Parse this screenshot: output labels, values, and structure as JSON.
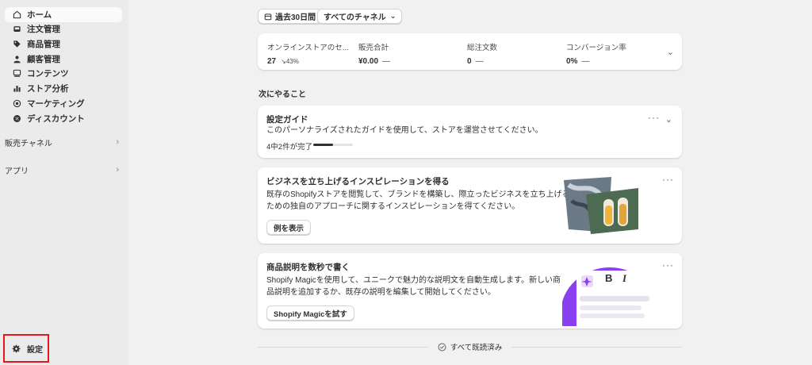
{
  "sidebar": {
    "items": [
      {
        "label": "ホーム",
        "icon": "home-icon"
      },
      {
        "label": "注文管理",
        "icon": "inbox-icon"
      },
      {
        "label": "商品管理",
        "icon": "tag-icon"
      },
      {
        "label": "顧客管理",
        "icon": "person-icon"
      },
      {
        "label": "コンテンツ",
        "icon": "content-icon"
      },
      {
        "label": "ストア分析",
        "icon": "bar-chart-icon"
      },
      {
        "label": "マーケティング",
        "icon": "target-icon"
      },
      {
        "label": "ディスカウント",
        "icon": "discount-icon"
      }
    ],
    "sales_channels": "販売チャネル",
    "apps": "アプリ",
    "settings": "設定"
  },
  "filters": {
    "date_range": "過去30日間",
    "channels": "すべてのチャネル"
  },
  "metrics": [
    {
      "label": "オンラインストアのセ...",
      "value": "27",
      "trend": "43%"
    },
    {
      "label": "販売合計",
      "value": "¥0.00",
      "trend": "—"
    },
    {
      "label": "総注文数",
      "value": "0",
      "trend": "—"
    },
    {
      "label": "コンバージョン率",
      "value": "0%",
      "trend": "—"
    }
  ],
  "next_section_title": "次にやること",
  "setup_guide": {
    "title": "設定ガイド",
    "description": "このパーソナライズされたガイドを使用して、ストアを運営させてください。",
    "progress_text": "4中2件が完了",
    "progress_fraction": 0.5
  },
  "inspiration_card": {
    "title": "ビジネスを立ち上げるインスピレーションを得る",
    "line1": "既存のShopifyストアを閲覧して、ブランドを構築し、際立ったビジネスを立ち上げる",
    "line2": "ための独自のアプローチに関するインスピレーションを得てください。",
    "button": "例を表示"
  },
  "magic_card": {
    "title": "商品説明を数秒で書く",
    "line1": "Shopify Magicを使用して、ユニークで魅力的な説明文を自動生成します。新しい商",
    "line2": "品説明を追加するか、既存の説明を編集して開始してください。",
    "button": "Shopify Magicを試す",
    "toolbar_bold": "B",
    "toolbar_italic": "I"
  },
  "footer": {
    "all_read": "すべて既読済み"
  },
  "colors": {
    "sidebar_bg": "#ebebeb",
    "page_bg": "#f1f1f1",
    "highlight_border": "#e5171b",
    "magic_purple": "#8a3ff0"
  }
}
